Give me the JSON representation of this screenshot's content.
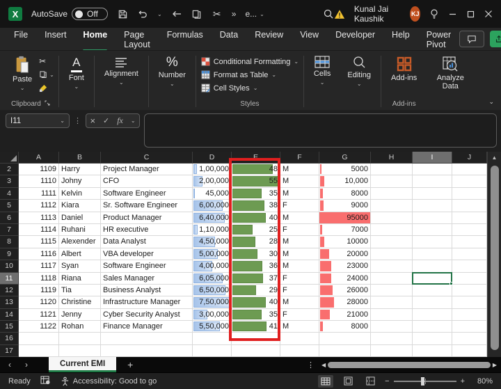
{
  "titlebar": {
    "app_logo": "X",
    "autosave_label": "AutoSave",
    "autosave_state": "Off",
    "overflow": "»",
    "doc_dropdown": "e...",
    "user_name": "Kunal Jai Kaushik",
    "user_initials": "KJ"
  },
  "ribbon_tabs": [
    {
      "label": "File",
      "active": false
    },
    {
      "label": "Insert",
      "active": false
    },
    {
      "label": "Home",
      "active": true
    },
    {
      "label": "Page Layout",
      "active": false
    },
    {
      "label": "Formulas",
      "active": false
    },
    {
      "label": "Data",
      "active": false
    },
    {
      "label": "Review",
      "active": false
    },
    {
      "label": "View",
      "active": false
    },
    {
      "label": "Developer",
      "active": false
    },
    {
      "label": "Help",
      "active": false
    },
    {
      "label": "Power Pivot",
      "active": false
    }
  ],
  "ribbon": {
    "paste": "Paste",
    "clipboard_group": "Clipboard",
    "font_button": "Font",
    "alignment_button": "Alignment",
    "number_button": "Number",
    "conditional_formatting": "Conditional Formatting",
    "format_as_table": "Format as Table",
    "cell_styles": "Cell Styles",
    "styles_group": "Styles",
    "cells_button": "Cells",
    "editing_button": "Editing",
    "addins_button": "Add-ins",
    "addins_group": "Add-ins",
    "analyze_data": "Analyze Data"
  },
  "formula_bar": {
    "name_box": "I11",
    "cancel": "×",
    "enter": "✓",
    "fx": "fx",
    "formula": ""
  },
  "grid": {
    "column_headers": [
      "A",
      "B",
      "C",
      "D",
      "E",
      "F",
      "G",
      "H",
      "I",
      "J"
    ],
    "selected_column": "I",
    "selected_row": 11,
    "selected_cell": "I11",
    "first_row": 2,
    "last_row": 17,
    "max_salary": 750000,
    "max_age": 55,
    "max_emi": 95000,
    "rows": [
      {
        "row": 2,
        "id": "1109",
        "name": "Harry",
        "title": "Project Manager",
        "salary": "1,00,000",
        "salary_val": 100000,
        "age": "48",
        "age_val": 48,
        "gender": "M",
        "emi": "5000",
        "emi_val": 5000
      },
      {
        "row": 3,
        "id": "1110",
        "name": "Johny",
        "title": "CFO",
        "salary": "2,00,000",
        "salary_val": 200000,
        "age": "55",
        "age_val": 55,
        "gender": "M",
        "emi": "10,000",
        "emi_val": 10000
      },
      {
        "row": 4,
        "id": "1111",
        "name": "Kelvin",
        "title": "Software Engineer",
        "salary": "45,000",
        "salary_val": 45000,
        "age": "35",
        "age_val": 35,
        "gender": "M",
        "emi": "8000",
        "emi_val": 8000
      },
      {
        "row": 5,
        "id": "1112",
        "name": "Kiara",
        "title": "Sr. Software Engineer",
        "salary": "6,00,000",
        "salary_val": 600000,
        "age": "38",
        "age_val": 38,
        "gender": "F",
        "emi": "9000",
        "emi_val": 9000
      },
      {
        "row": 6,
        "id": "1113",
        "name": "Daniel",
        "title": "Product Manager",
        "salary": "6,40,000",
        "salary_val": 640000,
        "age": "40",
        "age_val": 40,
        "gender": "M",
        "emi": "95000",
        "emi_val": 95000
      },
      {
        "row": 7,
        "id": "1114",
        "name": "Ruhani",
        "title": "HR executive",
        "salary": "1,10,000",
        "salary_val": 110000,
        "age": "25",
        "age_val": 25,
        "gender": "F",
        "emi": "7000",
        "emi_val": 7000
      },
      {
        "row": 8,
        "id": "1115",
        "name": "Alexender",
        "title": "Data Analyst",
        "salary": "4,50,000",
        "salary_val": 450000,
        "age": "28",
        "age_val": 28,
        "gender": "M",
        "emi": "10000",
        "emi_val": 10000
      },
      {
        "row": 9,
        "id": "1116",
        "name": "Albert",
        "title": "VBA developer",
        "salary": "5,00,000",
        "salary_val": 500000,
        "age": "30",
        "age_val": 30,
        "gender": "M",
        "emi": "20000",
        "emi_val": 20000
      },
      {
        "row": 10,
        "id": "1117",
        "name": "Syan",
        "title": "Software Engineer",
        "salary": "4,00,000",
        "salary_val": 400000,
        "age": "36",
        "age_val": 36,
        "gender": "M",
        "emi": "23000",
        "emi_val": 23000
      },
      {
        "row": 11,
        "id": "1118",
        "name": "Riana",
        "title": "Sales Manager",
        "salary": "6,05,000",
        "salary_val": 605000,
        "age": "37",
        "age_val": 37,
        "gender": "F",
        "emi": "24000",
        "emi_val": 24000
      },
      {
        "row": 12,
        "id": "1119",
        "name": "Tia",
        "title": "Business Analyst",
        "salary": "6,50,000",
        "salary_val": 650000,
        "age": "29",
        "age_val": 29,
        "gender": "F",
        "emi": "26000",
        "emi_val": 26000
      },
      {
        "row": 13,
        "id": "1120",
        "name": "Christine",
        "title": "Infrastructure Manager",
        "salary": "7,50,000",
        "salary_val": 750000,
        "age": "40",
        "age_val": 40,
        "gender": "M",
        "emi": "28000",
        "emi_val": 28000
      },
      {
        "row": 14,
        "id": "1121",
        "name": "Jenny",
        "title": "Cyber Security Analyst",
        "salary": "3,00,000",
        "salary_val": 300000,
        "age": "35",
        "age_val": 35,
        "gender": "F",
        "emi": "21000",
        "emi_val": 21000
      },
      {
        "row": 15,
        "id": "1122",
        "name": "Rohan",
        "title": "Finance Manager",
        "salary": "5,50,000",
        "salary_val": 550000,
        "age": "41",
        "age_val": 41,
        "gender": "M",
        "emi": "8000",
        "emi_val": 8000
      }
    ]
  },
  "sheet_bar": {
    "active_tab": "Current EMI",
    "new_sheet": "+"
  },
  "status_bar": {
    "ready": "Ready",
    "accessibility": "Accessibility: Good to go",
    "zoom": "80%"
  },
  "colors": {
    "accent_green": "#217346",
    "tab_underline": "#2f9e68",
    "bar_blue": "#a7c4ea",
    "bar_green": "#6d9b52",
    "bar_red": "#f96e6e",
    "highlight_red_box": "#e01f1f",
    "avatar_orange": "#c0501f",
    "warning_yellow": "#f2c230"
  }
}
